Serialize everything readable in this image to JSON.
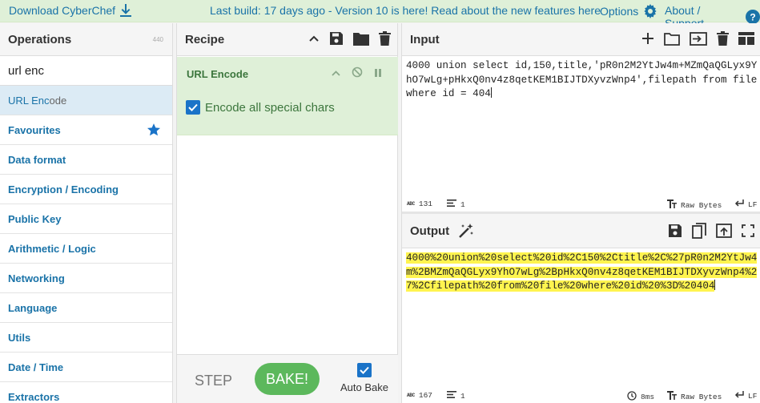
{
  "banner": {
    "download_label": "Download CyberChef",
    "build_text": "Last build: 17 days ago - Version 10 is here! Read about the new features here",
    "options_label": "Options",
    "about_label": "About / Support"
  },
  "operations": {
    "title": "Operations",
    "count": "440",
    "search_value": "url enc",
    "result_highlight": "URL Enc",
    "result_rest": "ode",
    "categories": [
      "Favourites",
      "Data format",
      "Encryption / Encoding",
      "Public Key",
      "Arithmetic / Logic",
      "Networking",
      "Language",
      "Utils",
      "Date / Time",
      "Extractors"
    ]
  },
  "recipe": {
    "title": "Recipe",
    "op_name": "URL Encode",
    "option_label": "Encode all special chars",
    "step_label": "STEP",
    "bake_label": "BAKE!",
    "autobake_label": "Auto Bake"
  },
  "input": {
    "title": "Input",
    "text": "4000 union select id,150,title,'pR0n2M2YtJw4m+MZmQaQGLyx9YhO7wLg+pHkxQ0nv4z8qetKEM1BIJTDXyvzWnp4',filepath from file where id = 404",
    "length": "131",
    "lines": "1",
    "encoding": "Raw Bytes",
    "eol": "LF"
  },
  "output": {
    "title": "Output",
    "text": "4000%20union%20select%20id%2C150%2Ctitle%2C%27pR0n2M2YtJw4m%2BMZmQaQGLyx9YhO7wLg%2BpHkxQ0nv4z8qetKEM1BIJTDXyvzWnp4%27%2Cfilepath%20from%20file%20where%20id%20%3D%20404",
    "length": "167",
    "lines": "1",
    "time": "8ms",
    "encoding": "Raw Bytes",
    "eol": "LF"
  },
  "colors": {
    "banner_bg": "#dff0d8",
    "link": "#1a73a8",
    "bake": "#5cb85c",
    "highlight": "#fff44f"
  }
}
